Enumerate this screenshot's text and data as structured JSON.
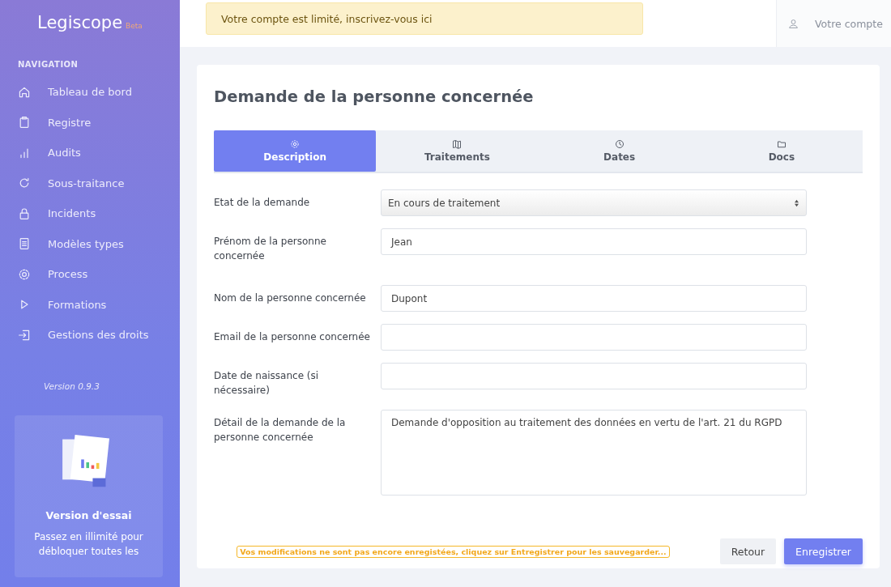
{
  "sidebar": {
    "logo": "Legiscope",
    "logo_badge": "Beta",
    "section": "NAVIGATION",
    "items": [
      {
        "label": "Tableau de bord"
      },
      {
        "label": "Registre"
      },
      {
        "label": "Audits"
      },
      {
        "label": "Sous-traitance"
      },
      {
        "label": "Incidents"
      },
      {
        "label": "Modèles types"
      },
      {
        "label": "Process"
      },
      {
        "label": "Formations"
      },
      {
        "label": "Gestions des droits"
      }
    ],
    "version": "Version 0.9.3",
    "trial": {
      "title": "Version d'essai",
      "text": "Passez en illimité pour débloquer toutes les"
    }
  },
  "header": {
    "alert": "Votre compte est limité, inscrivez-vous ici",
    "account": "Votre compte"
  },
  "page": {
    "title": "Demande de la personne concernée",
    "tabs": [
      {
        "label": "Description",
        "selected": true
      },
      {
        "label": "Traitements",
        "selected": false
      },
      {
        "label": "Dates",
        "selected": false
      },
      {
        "label": "Docs",
        "selected": false
      }
    ],
    "fields": [
      {
        "kind": "select",
        "label": "Etat de la demande",
        "value": "En cours de traitement"
      },
      {
        "kind": "input",
        "label": "Prénom de la personne concernée",
        "value": "Jean"
      },
      {
        "kind": "input",
        "label": "Nom de la personne concernée",
        "value": "Dupont"
      },
      {
        "kind": "input",
        "label": "Email de la personne concernée"
      },
      {
        "kind": "input",
        "label": "Date de naissance (si nécessaire)"
      },
      {
        "kind": "textarea",
        "label": "Détail de la demande de la personne concernée",
        "value": "Demande d'opposition au traitement des données en vertu de l'art. 21 du RGPD"
      }
    ],
    "unsaved_notice": "Vos modifications ne sont pas encore enregistées, cliquez sur Entregistrer pour les sauvegarder...",
    "buttons": [
      {
        "kind": "secondary",
        "label": "Retour"
      },
      {
        "kind": "primary",
        "label": "Enregistrer"
      }
    ]
  }
}
